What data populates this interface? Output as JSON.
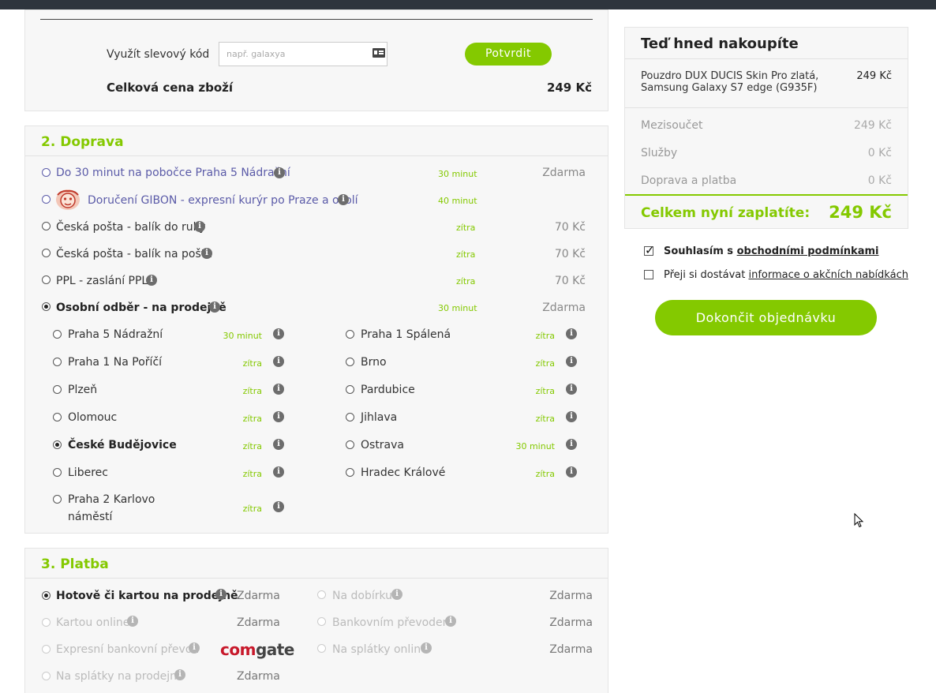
{
  "discount": {
    "label": "Využít slevový kód",
    "placeholder": "např. galaxya",
    "confirm_label": "Potvrdit",
    "total_label": "Celková cena zboží",
    "total_value": "249 Kč"
  },
  "shipping": {
    "title": "2. Doprava",
    "options": [
      {
        "label": "Do 30 minut na pobočce Praha 5 Nádražní",
        "eta": "30 minut",
        "price": "Zdarma"
      },
      {
        "label": "Doručení GIBON - expresní kurýr po Praze a okolí",
        "eta": "40 minut",
        "price": ""
      },
      {
        "label": "Česká pošta - balík do ruky",
        "eta": "zítra",
        "price": "70 Kč"
      },
      {
        "label": "Česká pošta - balík na poštu",
        "eta": "zítra",
        "price": "70 Kč"
      },
      {
        "label": "PPL - zaslání PPL",
        "eta": "zítra",
        "price": "70 Kč"
      },
      {
        "label": "Osobní odběr - na prodejně",
        "eta": "30 minut",
        "price": "Zdarma"
      }
    ],
    "stores_left": [
      {
        "label": "Praha 5 Nádražní",
        "eta": "30 minut"
      },
      {
        "label": "Praha 1 Na Poříčí",
        "eta": "zítra"
      },
      {
        "label": "Plzeň",
        "eta": "zítra"
      },
      {
        "label": "Olomouc",
        "eta": "zítra"
      },
      {
        "label": "České Budějovice",
        "eta": "zítra"
      },
      {
        "label": "Liberec",
        "eta": "zítra"
      },
      {
        "label": "Praha 2 Karlovo",
        "label2": "náměstí",
        "eta": "zítra"
      }
    ],
    "stores_right": [
      {
        "label": "Praha 1 Spálená",
        "eta": "zítra"
      },
      {
        "label": "Brno",
        "eta": "zítra"
      },
      {
        "label": "Pardubice",
        "eta": "zítra"
      },
      {
        "label": "Jihlava",
        "eta": "zítra"
      },
      {
        "label": "Ostrava",
        "eta": "30 minut"
      },
      {
        "label": "Hradec Králové",
        "eta": "zítra"
      }
    ]
  },
  "payment": {
    "title": "3. Platba",
    "left": [
      {
        "label": "Hotově či kartou na prodejně",
        "price": "Zdarma"
      },
      {
        "label": "Kartou online",
        "price": "Zdarma"
      },
      {
        "label": "Expresní bankovní převod",
        "price": ""
      },
      {
        "label": "Na splátky na prodejně",
        "price": "Zdarma"
      }
    ],
    "right": [
      {
        "label": "Na dobírku",
        "price": "Zdarma"
      },
      {
        "label": "Bankovním převodem",
        "price": "Zdarma"
      },
      {
        "label": "Na splátky online",
        "price": "Zdarma"
      }
    ],
    "comgate_a": "com",
    "comgate_b": "gate"
  },
  "summary": {
    "title": "Teď hned nakoupíte",
    "item_name_1": "Pouzdro DUX DUCIS Skin Pro zlatá,",
    "item_name_2": "Samsung Galaxy S7 edge (G935F)",
    "item_price": "249 Kč",
    "rows": [
      {
        "label": "Mezisoučet",
        "value": "249 Kč"
      },
      {
        "label": "Služby",
        "value": "0 Kč"
      },
      {
        "label": "Doprava a platba",
        "value": "0 Kč"
      }
    ],
    "total_label": "Celkem nyní zaplatíte:",
    "total_value": "249 Kč"
  },
  "consent": {
    "terms_prefix": "Souhlasím s",
    "terms_link": "obchodními podmínkami",
    "news_prefix": "Přeji si dostávat",
    "news_link": "informace o akčních nabídkách"
  },
  "finish_label": "Dokončit objednávku",
  "colors": {
    "accent": "#84c900",
    "link": "#5b5ba8",
    "topbar": "#2e353d"
  }
}
